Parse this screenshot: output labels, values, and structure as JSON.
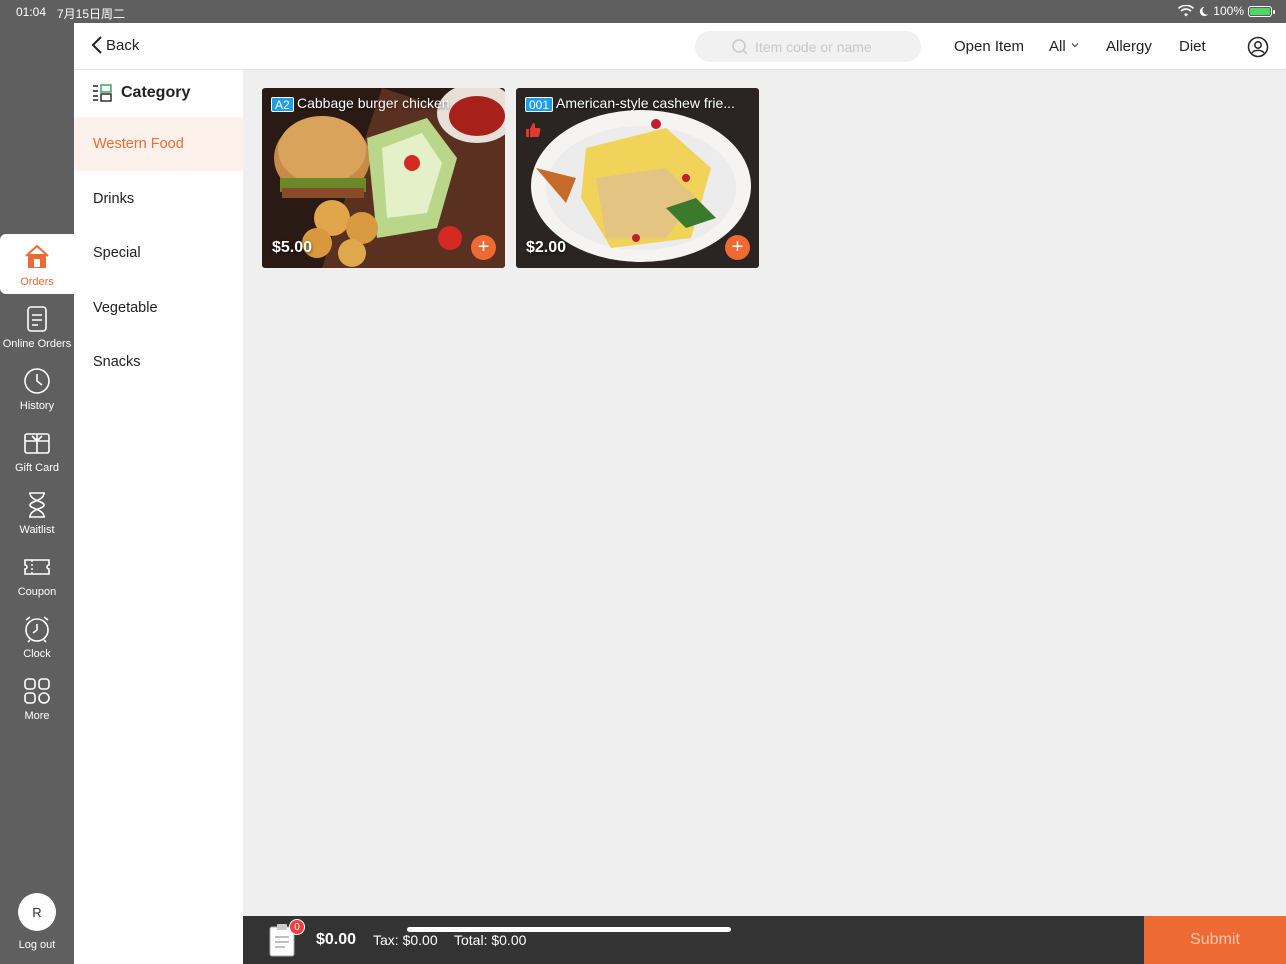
{
  "status_bar": {
    "time": "01:04",
    "date": "7月15日周二",
    "battery": "100%"
  },
  "rail": {
    "items": [
      {
        "label": "Orders",
        "icon": "home-icon",
        "active": true
      },
      {
        "label": "Online Orders",
        "icon": "document-icon"
      },
      {
        "label": "History",
        "icon": "clock-icon"
      },
      {
        "label": "Gift Card",
        "icon": "gift-card-icon"
      },
      {
        "label": "Waitlist",
        "icon": "hourglass-icon"
      },
      {
        "label": "Coupon",
        "icon": "ticket-icon"
      },
      {
        "label": "Clock",
        "icon": "alarm-clock-icon"
      },
      {
        "label": "More",
        "icon": "grid-icon"
      }
    ],
    "logout": {
      "avatar": "R",
      "label": "Log out"
    }
  },
  "topbar": {
    "back_label": "Back",
    "search_placeholder": "Item code or name",
    "open_item": "Open Item",
    "filter_all": "All",
    "allergy": "Allergy",
    "diet": "Diet"
  },
  "categories": {
    "header": "Category",
    "items": [
      "Western Food",
      "Drinks",
      "Special",
      "Vegetable",
      "Snacks"
    ],
    "active": "Western Food"
  },
  "items": [
    {
      "code": "A2",
      "name": "Cabbage burger chicken",
      "price": "$5.00"
    },
    {
      "code": "001",
      "name": "American-style cashew frie...",
      "price": "$2.00",
      "recommended": true
    }
  ],
  "cart": {
    "count": "0",
    "subtotal": "$0.00",
    "tax": "Tax: $0.00",
    "total": "Total: $0.00",
    "submit_label": "Submit"
  },
  "colors": {
    "accent": "#ee6a34",
    "rail": "#5f5f5f",
    "code_badge": "#1e9de8"
  }
}
